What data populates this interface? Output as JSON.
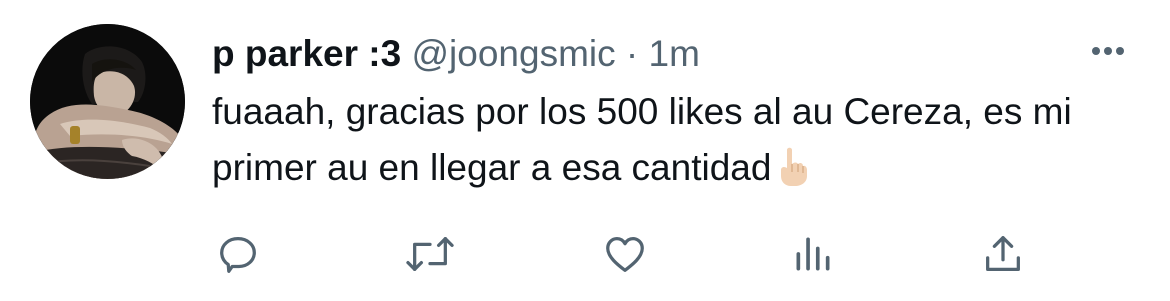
{
  "tweet": {
    "display_name": "p parker :3",
    "handle": "@joongsmic",
    "separator": "·",
    "time": "1m",
    "text": "fuaaah, gracias por los 500 likes al au Cereza, es mi primer au en llegar a esa cantidad",
    "emoji": "index-pointing-up-emoji"
  },
  "icons": {
    "more": "more-icon",
    "reply": "reply-icon",
    "retweet": "retweet-icon",
    "like": "like-icon",
    "analytics": "analytics-icon",
    "share": "share-icon"
  },
  "colors": {
    "text": "#0f1419",
    "secondary": "#536471",
    "icon": "#536471",
    "background": "#ffffff"
  }
}
